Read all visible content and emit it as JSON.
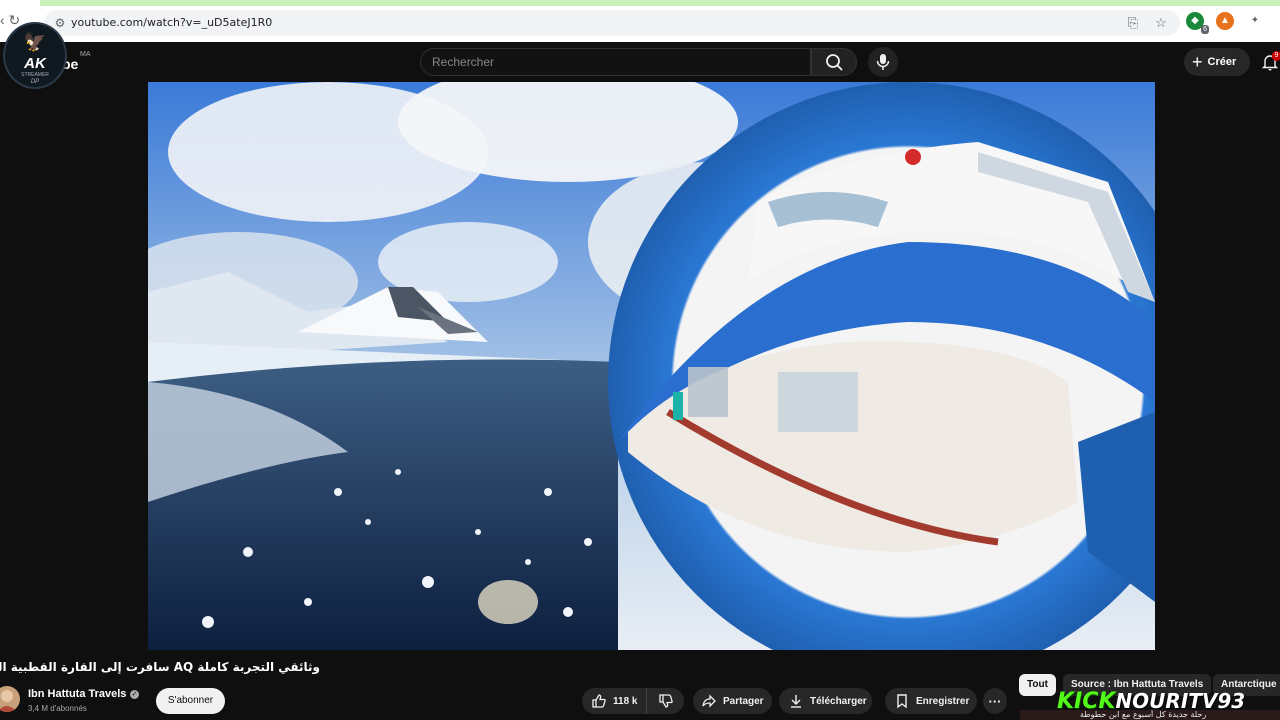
{
  "browser": {
    "url": "youtube.com/watch?v=_uD5ateJ1R0",
    "extension_badge": "6"
  },
  "header": {
    "logo_text": "AK",
    "logo_subtitle": "STREAMER",
    "logo_subtitle2": "DP",
    "youtube_word": "be",
    "country_code": "MA",
    "search_placeholder": "Rechercher",
    "create_label": "Créer",
    "notification_count": "9"
  },
  "video": {
    "title": "وثائقي التجربة كاملة AQ سافرت إلى القارة القطبية المتجمدة أنتاركتيكا",
    "channel_name": "Ibn Hattuta Travels",
    "subscribers": "3,4 M d'abonnés",
    "subscribe_label": "S'abonner",
    "likes": "118 k",
    "share_label": "Partager",
    "download_label": "Télécharger",
    "save_label": "Enregistrer",
    "more_label": "···"
  },
  "chips": {
    "all": "Tout",
    "source": "Source : Ibn Hattuta Travels",
    "antarctic": "Antarctique"
  },
  "overlay": {
    "kick_brand": "KICK",
    "kick_user": "NOURITV93",
    "ticker_text": "رحلة جديدة كل أسبوع مع ابن حطوطة"
  },
  "colors": {
    "kick_green": "#53fc18",
    "ship_blue": "#2a78d4",
    "background": "#0f0f0f"
  }
}
